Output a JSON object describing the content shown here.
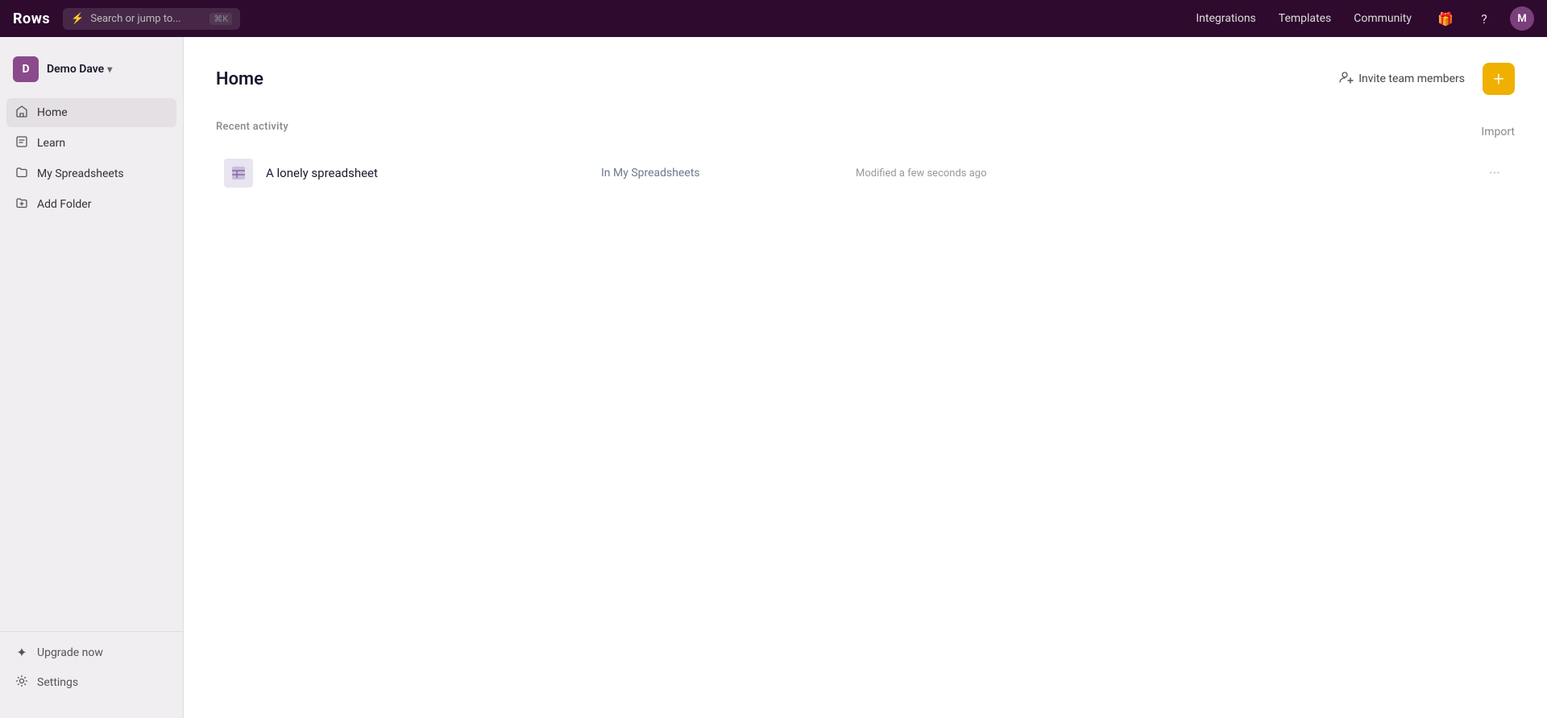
{
  "app": {
    "logo": "Rows"
  },
  "topbar": {
    "search_placeholder": "Search or jump to...",
    "search_kbd": "⌘K",
    "nav_items": [
      "Integrations",
      "Templates",
      "Community"
    ],
    "avatar_label": "M"
  },
  "sidebar": {
    "user_avatar": "D",
    "user_name": "Demo Dave",
    "nav_items": [
      {
        "id": "home",
        "label": "Home",
        "icon": "🏠",
        "active": true
      },
      {
        "id": "learn",
        "label": "Learn",
        "icon": "📖",
        "active": false
      },
      {
        "id": "my-spreadsheets",
        "label": "My Spreadsheets",
        "icon": "📁",
        "active": false
      },
      {
        "id": "add-folder",
        "label": "Add Folder",
        "icon": "📂+",
        "active": false
      }
    ],
    "bottom_items": [
      {
        "id": "upgrade",
        "label": "Upgrade now",
        "icon": "✦"
      },
      {
        "id": "settings",
        "label": "Settings",
        "icon": "⚙"
      }
    ]
  },
  "main": {
    "page_title": "Home",
    "invite_label": "Invite team members",
    "new_button_label": "+",
    "recent_activity_label": "Recent activity",
    "import_label": "Import",
    "spreadsheets": [
      {
        "name": "A lonely spreadsheet",
        "location": "In My Spreadsheets",
        "modified": "Modified a few seconds ago"
      }
    ]
  }
}
